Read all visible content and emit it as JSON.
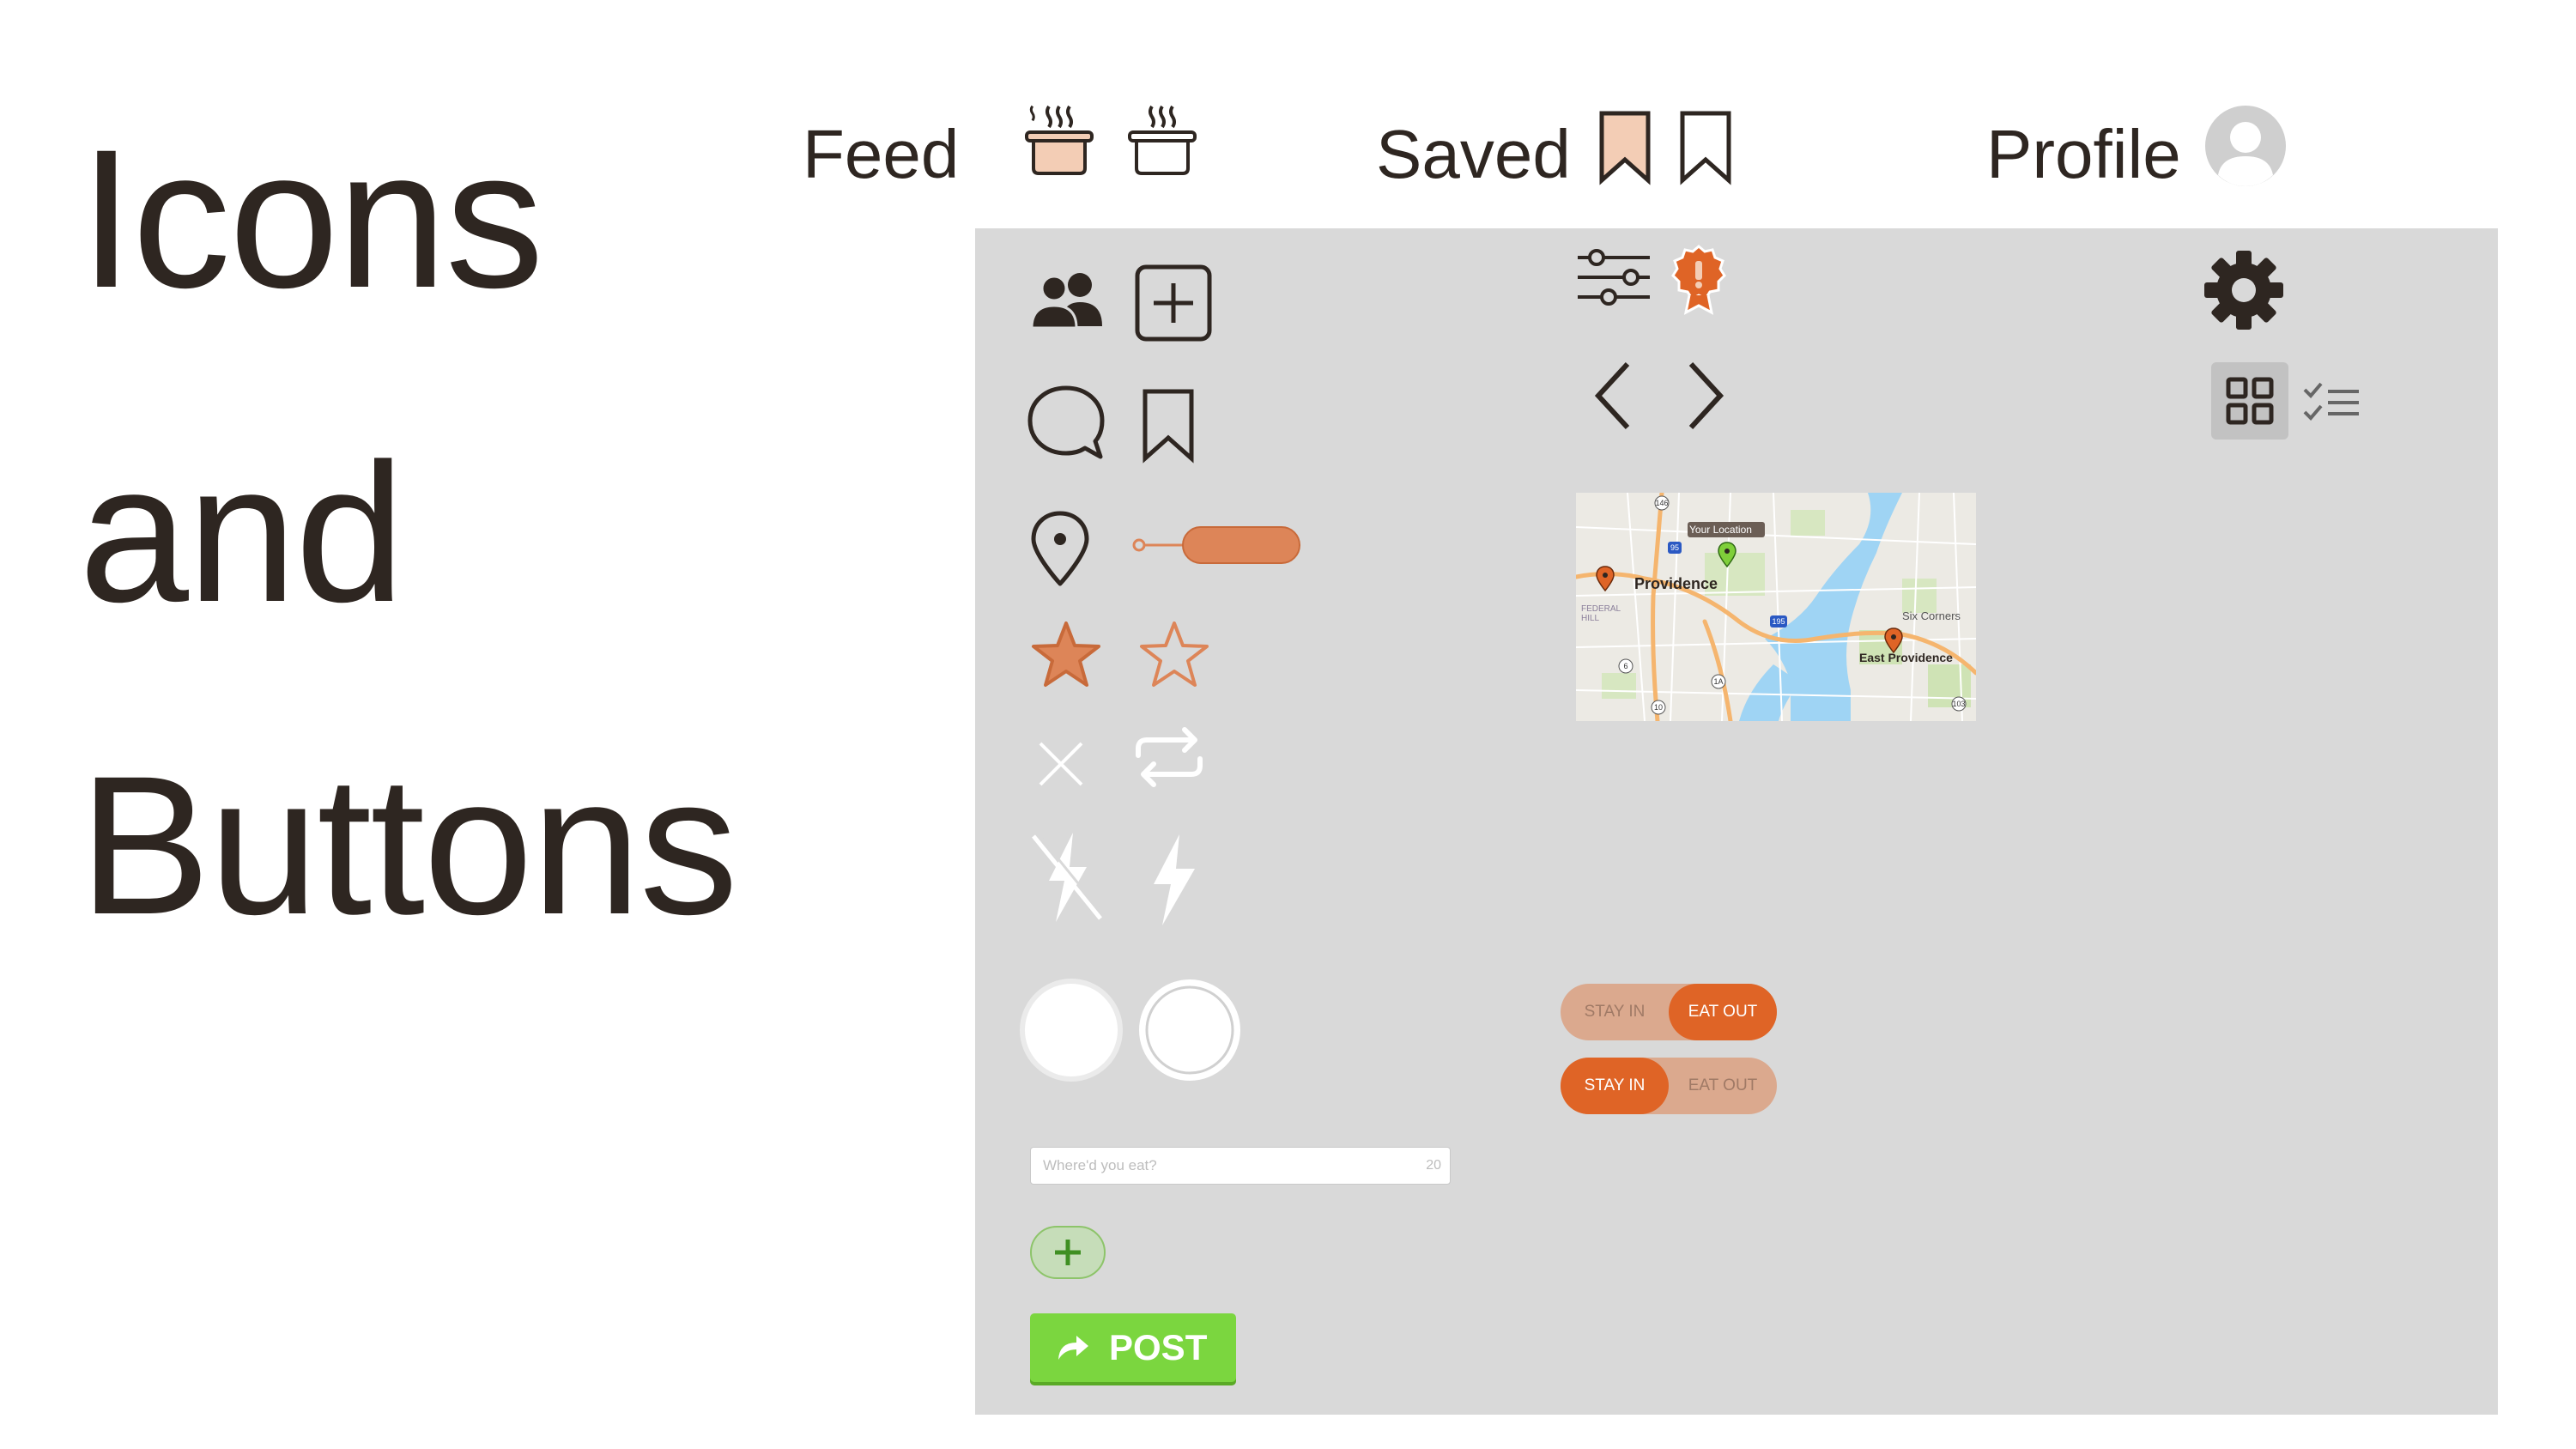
{
  "title": {
    "line1": "Icons",
    "line2": "and",
    "line3": "Buttons"
  },
  "nav": {
    "feed_label": "Feed",
    "saved_label": "Saved",
    "profile_label": "Profile"
  },
  "icons": [
    "pot-filled-icon",
    "pot-outline-icon",
    "bookmark-filled-icon",
    "bookmark-outline-icon",
    "avatar-icon",
    "users-icon",
    "add-square-icon",
    "chat-bubble-icon",
    "bookmark-icon",
    "location-pin-icon",
    "slider-pill-icon",
    "star-filled-icon",
    "star-outline-icon",
    "close-icon",
    "repost-icon",
    "flash-off-icon",
    "flash-icon",
    "shutter-button-icon",
    "filter-sliders-icon",
    "badge-icon",
    "chevron-left-icon",
    "chevron-right-icon",
    "gear-icon",
    "grid-view-icon",
    "checklist-view-icon",
    "plus-icon",
    "share-arrow-icon"
  ],
  "map": {
    "your_location_label": "Your Location",
    "city_label": "Providence",
    "east_label": "East Providence",
    "six_corners_label": "Six Corners",
    "federal_hill_label": "FEDERAL HILL",
    "route_labels": [
      "146",
      "95",
      "195",
      "6",
      "10",
      "1A",
      "103"
    ]
  },
  "toggles": {
    "stay_in_label": "STAY IN",
    "eat_out_label": "EAT OUT"
  },
  "composer": {
    "placeholder": "Where'd you eat?",
    "char_count": "20"
  },
  "post_button": {
    "label": "POST"
  },
  "colors": {
    "text_dark": "#2e2621",
    "accent_orange": "#df6426",
    "soft_orange": "#dd8558",
    "peach": "#f3cdb5",
    "panel_gray": "#d9d9d9",
    "post_green": "#7bd63f"
  }
}
